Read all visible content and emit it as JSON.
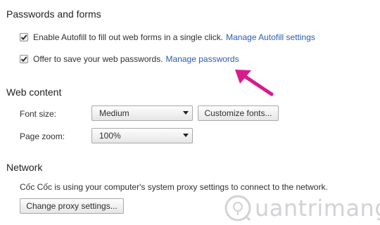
{
  "passwords": {
    "title": "Passwords and forms",
    "autofill": {
      "text": "Enable Autofill to fill out web forms in a single click.",
      "link": "Manage Autofill settings",
      "checked": true
    },
    "save_passwords": {
      "text": "Offer to save your web passwords.",
      "link": "Manage passwords",
      "checked": true
    }
  },
  "web_content": {
    "title": "Web content",
    "font_size": {
      "label": "Font size:",
      "value": "Medium",
      "button": "Customize fonts..."
    },
    "page_zoom": {
      "label": "Page zoom:",
      "value": "100%"
    }
  },
  "network": {
    "title": "Network",
    "description": "Cốc Cốc is using your computer's system proxy settings to connect to the network.",
    "button": "Change proxy settings..."
  },
  "watermark": {
    "text": "uantrimang"
  },
  "colors": {
    "link": "#2a5db0",
    "annotation_arrow": "#d81b8c"
  }
}
